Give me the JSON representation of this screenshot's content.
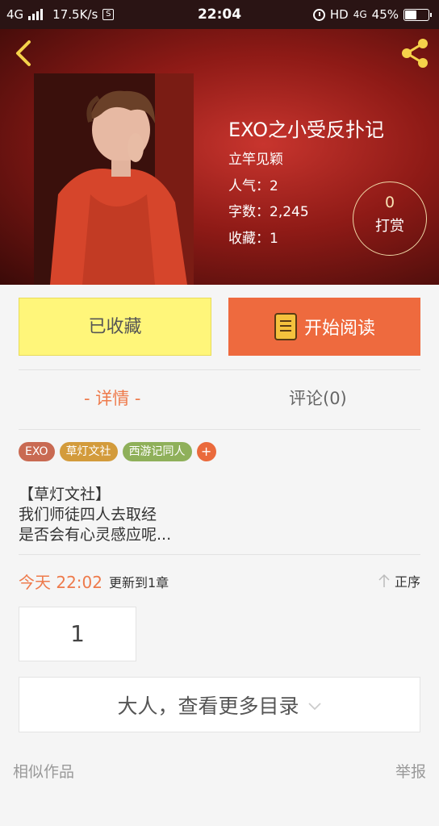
{
  "status_bar": {
    "network": "4G",
    "speed": "17.5K/s",
    "sim_icon": "S",
    "time": "22:04",
    "hd": "HD",
    "network2": "4G",
    "battery": "45%"
  },
  "header": {
    "back_icon": "chevron-left",
    "share_icon": "share",
    "book_title": "EXO之小受反扑记",
    "author": "立竿见颖",
    "popularity": "人气：2",
    "word_count": "字数：2,245",
    "favorites": "收藏：1",
    "reward_count": "0",
    "reward_label": "打赏"
  },
  "actions": {
    "collect_label": "已收藏",
    "read_label": "开始阅读"
  },
  "tabs": {
    "details": "- 详情 -",
    "comments": "评论(0)"
  },
  "tags": [
    {
      "label": "EXO",
      "color": "#c96a52"
    },
    {
      "label": "草灯文社",
      "color": "#d39b3b"
    },
    {
      "label": "西游记同人",
      "color": "#8fb05a"
    },
    {
      "label": "+",
      "color": "#ea6a3c"
    }
  ],
  "description": {
    "line1": "【草灯文社】",
    "line2": "我们师徒四人去取经",
    "line3": "是否会有心灵感应呢..."
  },
  "update": {
    "time": "今天 22:02",
    "text": "更新到1章",
    "sort_label": "正序"
  },
  "chapters": {
    "first": "1",
    "more_label": "大人，查看更多目录"
  },
  "footer": {
    "similar": "相似作品",
    "report": "举报"
  },
  "colors": {
    "accent": "#ee6a3e",
    "collect_bg": "#fff67a",
    "tab_active": "#ee7a4b"
  }
}
